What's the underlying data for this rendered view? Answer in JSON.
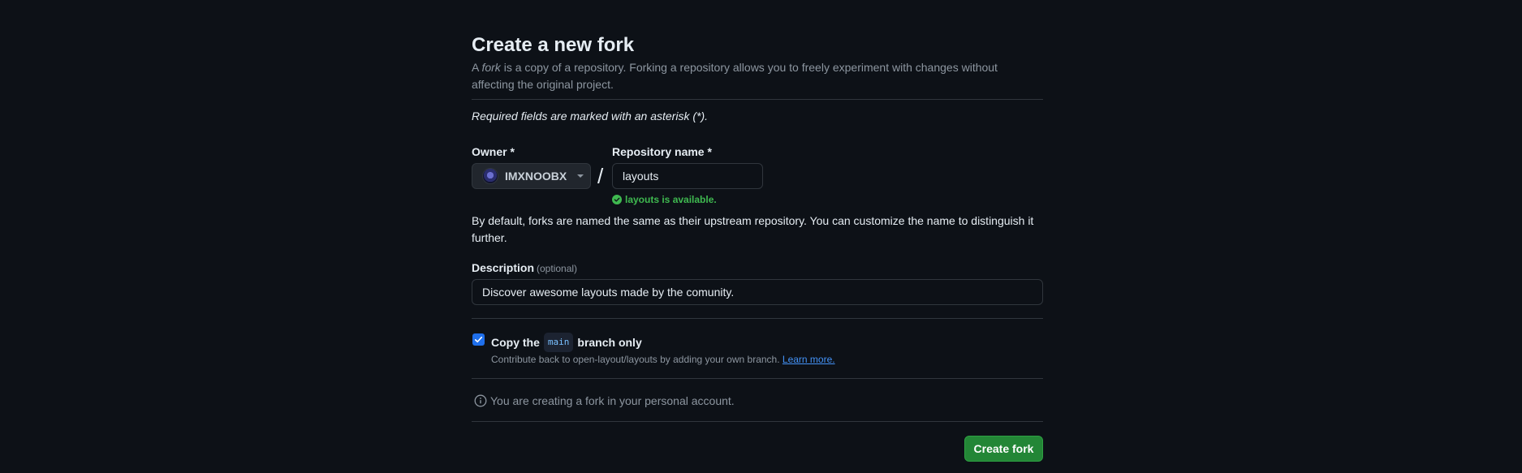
{
  "header": {
    "title": "Create a new fork",
    "subtitle_prefix": "A ",
    "subtitle_em": "fork",
    "subtitle_rest": " is a copy of a repository. Forking a repository allows you to freely experiment with changes without affecting the original project."
  },
  "form": {
    "required_note": "Required fields are marked with an asterisk (*).",
    "owner_label": "Owner *",
    "owner_value": "IMXNOOBX",
    "separator": "/",
    "repo_label": "Repository name *",
    "repo_value": "layouts",
    "availability": "layouts is available.",
    "default_note": "By default, forks are named the same as their upstream repository. You can customize the name to distinguish it further.",
    "description_label": "Description",
    "description_optional": "(optional)",
    "description_value": "Discover awesome layouts made by the comunity.",
    "copy_prefix": "Copy the",
    "copy_branch": "main",
    "copy_suffix": "branch only",
    "copy_checked": true,
    "contrib_text": "Contribute back to open-layout/layouts by adding your own branch.",
    "learn_more": "Learn more.",
    "info_text": "You are creating a fork in your personal account.",
    "submit_label": "Create fork"
  },
  "colors": {
    "background": "#0d1117",
    "success": "#3fb950",
    "accent": "#1f6feb",
    "button_green": "#238636",
    "link": "#4493f8"
  }
}
